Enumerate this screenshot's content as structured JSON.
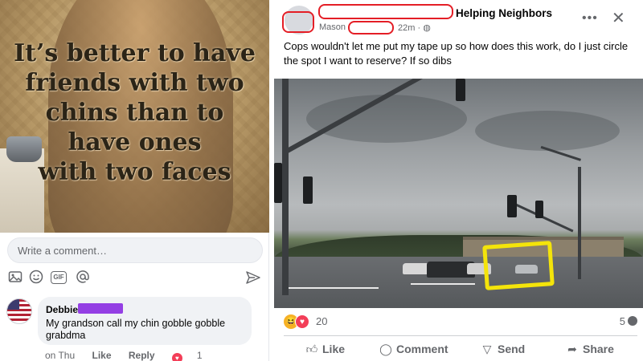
{
  "meme": {
    "lines": [
      "It’s better to have",
      "friends with two",
      "chins than to",
      "have ones",
      "with two faces"
    ]
  },
  "comment_input": {
    "placeholder": "Write a comment…"
  },
  "comment_tools": [
    "camera-icon",
    "emoji-icon",
    "gif-icon",
    "mention-icon",
    "send-icon"
  ],
  "comment": {
    "author": "Debbie",
    "text": "My grandson call my chin gobble  gobble grabdma",
    "time": "on Thu",
    "like_label": "Like",
    "reply_label": "Reply",
    "reaction_count": "1"
  },
  "post": {
    "group_name": "Helping Neighbors",
    "author": "Mason",
    "time": "22m",
    "text": "Cops wouldn't let me put my tape up so how does this work, do I just circle the spot I want to reserve? If so dibs",
    "reactions_count": "20",
    "comments_count": "5"
  },
  "actions": {
    "like": "Like",
    "comment": "Comment",
    "send": "Send",
    "share": "Share"
  },
  "colors": {
    "redaction_red": "#e41e26",
    "redaction_purple": "#8a2be2",
    "circle_yellow": "#f4e40a",
    "love": "#f33e58",
    "haha": "#f7b125"
  }
}
